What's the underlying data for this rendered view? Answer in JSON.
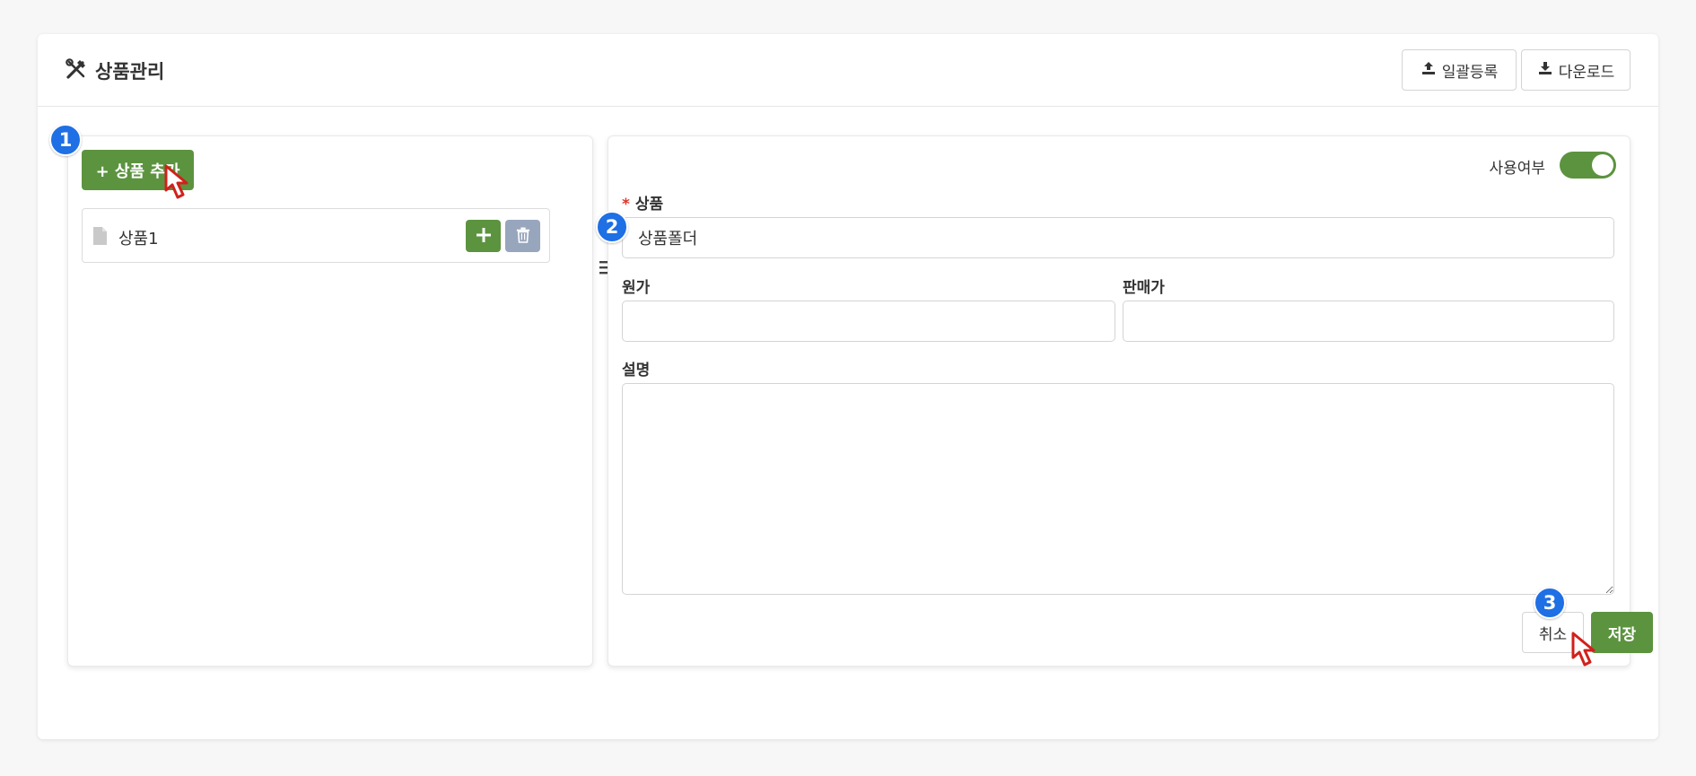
{
  "page": {
    "title": "상품관리",
    "title_icon": "tools-icon"
  },
  "header_actions": {
    "bulk_register_label": "일괄등록",
    "bulk_register_icon": "upload-icon",
    "download_label": "다운로드",
    "download_icon": "download-icon"
  },
  "tree": {
    "add_button_label": "+ 상품 추가",
    "items": [
      {
        "label": "상품1",
        "icon": "file-icon"
      }
    ]
  },
  "form": {
    "toggle_label": "사용여부",
    "toggle_on": true,
    "product_label": "상품",
    "product_required_mark": "*",
    "product_value": "상품폴더",
    "cost_label": "원가",
    "cost_value": "",
    "price_label": "판매가",
    "price_value": "",
    "description_label": "설명",
    "description_value": "",
    "cancel_label": "취소",
    "save_label": "저장"
  },
  "annotations": {
    "step1": "1",
    "step2": "2",
    "step3": "3"
  },
  "colors": {
    "primary_green": "#5c933f",
    "annotation_blue": "#1f6fe5",
    "delete_gray": "#98a6bd",
    "required_red": "#e0342a"
  }
}
